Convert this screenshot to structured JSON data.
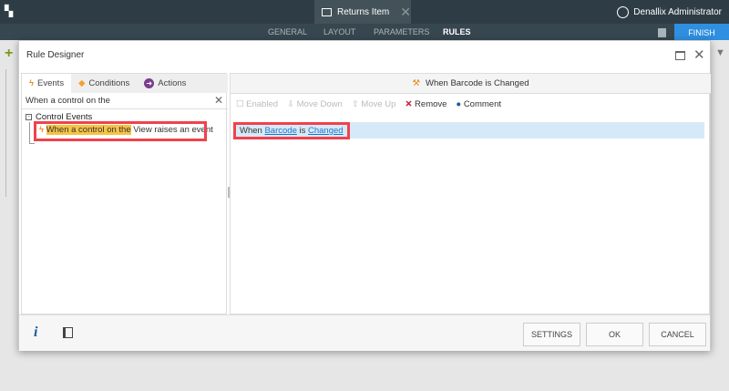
{
  "app": {
    "doc_tab": "Returns Item",
    "user": "Denallix Administrator",
    "nav": [
      "GENERAL",
      "LAYOUT",
      "PARAMETERS",
      "RULES"
    ],
    "finish": "FINISH"
  },
  "dialog": {
    "title": "Rule Designer",
    "tabs": [
      "Events",
      "Conditions",
      "Actions"
    ],
    "search_value": "When a control on the",
    "tree": {
      "group": "Control Events",
      "item_highlight": "When a control on the",
      "item_rest": " View raises an event"
    },
    "header": "When Barcode is Changed",
    "toolbar": [
      "Enabled",
      "Move Down",
      "Move Up",
      "Remove",
      "Comment"
    ],
    "rule": {
      "w1": "When ",
      "link1": "Barcode",
      "w2": " is ",
      "link2": "Changed"
    },
    "footer": {
      "info": "i",
      "settings": "SETTINGS",
      "ok": "OK",
      "cancel": "CANCEL"
    }
  }
}
